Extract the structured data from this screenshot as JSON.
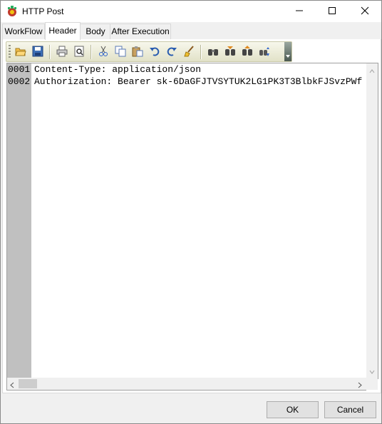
{
  "window": {
    "title": "HTTP Post"
  },
  "icons": {
    "app": "gear-tree-icon",
    "minimize": "minimize-icon",
    "maximize": "maximize-icon",
    "close": "close-icon"
  },
  "tabs": [
    {
      "label": "WorkFlow",
      "active": false
    },
    {
      "label": "Header",
      "active": true
    },
    {
      "label": "Body",
      "active": false
    },
    {
      "label": "After Execution",
      "active": false
    }
  ],
  "toolbar": {
    "buttons": [
      "open-folder-icon",
      "save-icon",
      "print-icon",
      "print-preview-icon",
      "cut-icon",
      "copy-icon",
      "paste-icon",
      "undo-icon",
      "redo-icon",
      "clear-brush-icon",
      "find-icon",
      "find-next-icon",
      "find-previous-icon",
      "replace-icon"
    ]
  },
  "editor": {
    "lines": [
      {
        "number": "0001",
        "text": "Content-Type: application/json"
      },
      {
        "number": "0002",
        "text": "Authorization: Bearer sk-6DaGFJTVSYTUK2LG1PK3T3BlbkFJSvzPWf"
      }
    ]
  },
  "footer": {
    "ok_label": "OK",
    "cancel_label": "Cancel"
  }
}
